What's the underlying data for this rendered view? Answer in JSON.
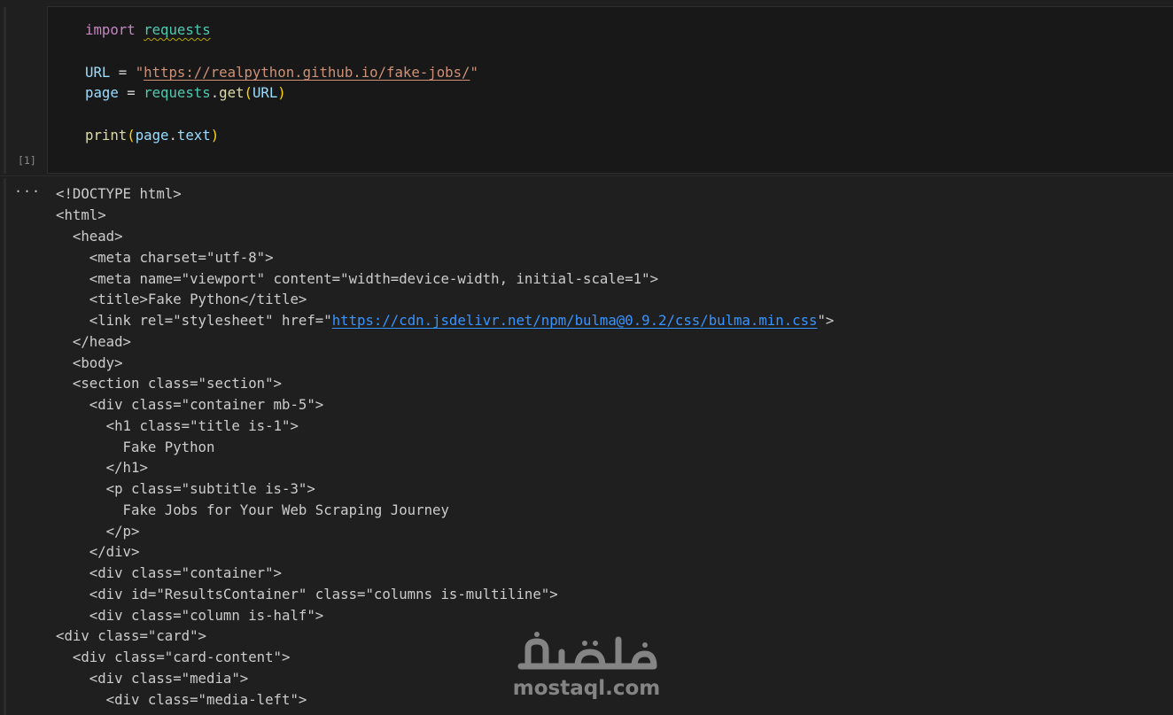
{
  "code_cell": {
    "execution_count": "[1]",
    "lines": {
      "l1": {
        "kw": "import",
        "mod": "requests"
      },
      "l2": {
        "var": "URL",
        "op": " = ",
        "q1": "\"",
        "url": "https://realpython.github.io/fake-jobs/",
        "q2": "\""
      },
      "l3": {
        "var": "page",
        "op": " = ",
        "mod": "requests",
        "dot": ".",
        "fn": "get",
        "lp": "(",
        "arg": "URL",
        "rp": ")"
      },
      "l4": {
        "fn": "print",
        "lp": "(",
        "obj": "page",
        "dot": ".",
        "attr": "text",
        "rp": ")"
      }
    }
  },
  "output": {
    "more_label": "···",
    "lines": [
      "<!DOCTYPE html>",
      "<html>",
      "  <head>",
      "    <meta charset=\"utf-8\">",
      "    <meta name=\"viewport\" content=\"width=device-width, initial-scale=1\">",
      "    <title>Fake Python</title>",
      "",
      "  </head>",
      "  <body>",
      "  <section class=\"section\">",
      "    <div class=\"container mb-5\">",
      "      <h1 class=\"title is-1\">",
      "        Fake Python",
      "      </h1>",
      "      <p class=\"subtitle is-3\">",
      "        Fake Jobs for Your Web Scraping Journey",
      "      </p>",
      "    </div>",
      "    <div class=\"container\">",
      "    <div id=\"ResultsContainer\" class=\"columns is-multiline\">",
      "    <div class=\"column is-half\">",
      "<div class=\"card\">",
      "  <div class=\"card-content\">",
      "    <div class=\"media\">",
      "      <div class=\"media-left\">"
    ],
    "link_line": {
      "prefix": "    <link rel=\"stylesheet\" href=\"",
      "url": "https://cdn.jsdelivr.net/npm/bulma@0.9.2/css/bulma.min.css",
      "suffix": "\">"
    }
  },
  "watermark": {
    "logo_name": "mostaql-logo",
    "text": "mostaql.com"
  }
}
